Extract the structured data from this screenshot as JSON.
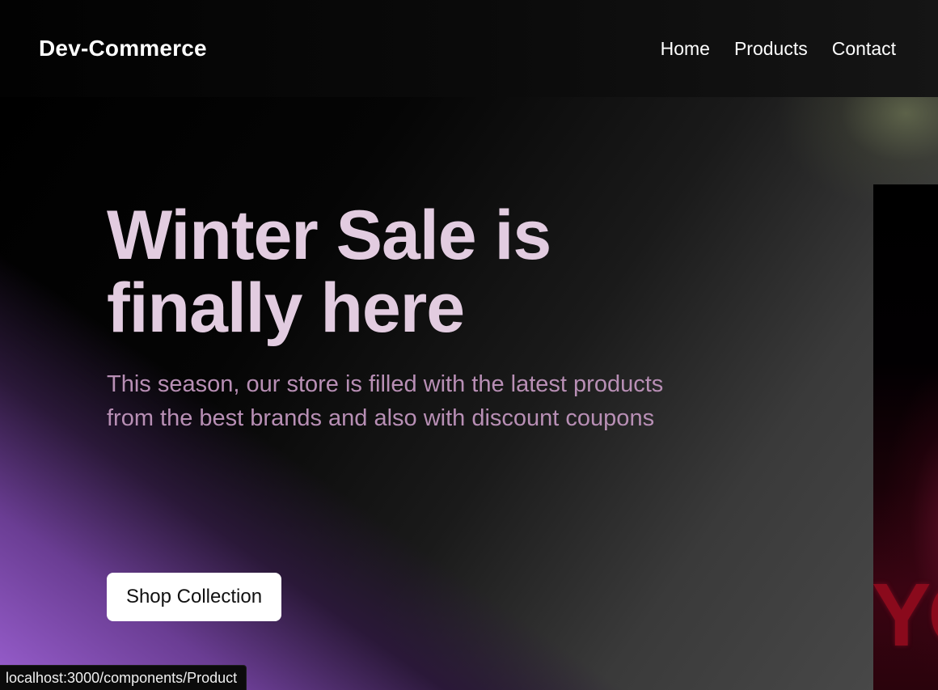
{
  "navbar": {
    "brand": "Dev-Commerce",
    "links": [
      "Home",
      "Products",
      "Contact"
    ]
  },
  "hero": {
    "title_line1": "Winter Sale is",
    "title_line2": "finally here",
    "subtitle": "This season, our store is filled with the latest products from the best brands and also with discount coupons",
    "cta_label": "Shop Collection"
  },
  "promo_image": {
    "visible_text": "YO"
  },
  "status_bar": {
    "url": "localhost:3000/components/Product"
  },
  "colors": {
    "title": "#e2cce0",
    "subtitle": "#b88fb5",
    "accent_purple": "#9a5fd0",
    "button_bg": "#ffffff",
    "navbar_bg": "#0a0a0a"
  }
}
